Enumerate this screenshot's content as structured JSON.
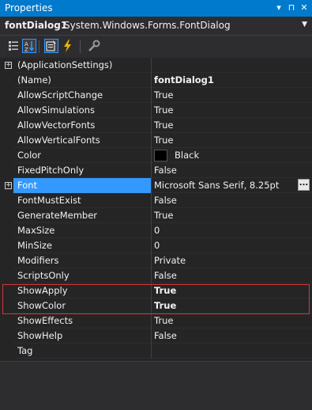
{
  "window": {
    "title": "Properties",
    "controls": [
      "▾",
      "⊓",
      "✕"
    ]
  },
  "object_selector": {
    "name": "fontDialog1",
    "type": "System.Windows.Forms.FontDialog"
  },
  "toolbar": {
    "buttons": [
      {
        "icon": "categorized-icon"
      },
      {
        "icon": "alphabetical-icon",
        "active": true
      },
      {
        "icon": "properties-icon",
        "active": true
      },
      {
        "icon": "events-icon"
      },
      {
        "icon": "property-pages-icon"
      }
    ]
  },
  "properties": [
    {
      "name": "(ApplicationSettings)",
      "value": "",
      "expandable": true
    },
    {
      "name": "(Name)",
      "value": "fontDialog1",
      "bold": true
    },
    {
      "name": "AllowScriptChange",
      "value": "True"
    },
    {
      "name": "AllowSimulations",
      "value": "True"
    },
    {
      "name": "AllowVectorFonts",
      "value": "True"
    },
    {
      "name": "AllowVerticalFonts",
      "value": "True"
    },
    {
      "name": "Color",
      "value": "Black",
      "swatch": "#000000"
    },
    {
      "name": "FixedPitchOnly",
      "value": "False"
    },
    {
      "name": "Font",
      "value": "Microsoft Sans Serif, 8.25pt",
      "expandable": true,
      "selected": true,
      "ellipsis": "..."
    },
    {
      "name": "FontMustExist",
      "value": "False"
    },
    {
      "name": "GenerateMember",
      "value": "True"
    },
    {
      "name": "MaxSize",
      "value": "0"
    },
    {
      "name": "MinSize",
      "value": "0"
    },
    {
      "name": "Modifiers",
      "value": "Private"
    },
    {
      "name": "ScriptsOnly",
      "value": "False"
    },
    {
      "name": "ShowApply",
      "value": "True",
      "bold": true,
      "flagged": true
    },
    {
      "name": "ShowColor",
      "value": "True",
      "bold": true,
      "flagged": true
    },
    {
      "name": "ShowEffects",
      "value": "True"
    },
    {
      "name": "ShowHelp",
      "value": "False"
    },
    {
      "name": "Tag",
      "value": ""
    }
  ],
  "colors": {
    "accent": "#007acc",
    "selection": "#3399ff",
    "flag_border": "#d23838",
    "background": "#252526"
  }
}
